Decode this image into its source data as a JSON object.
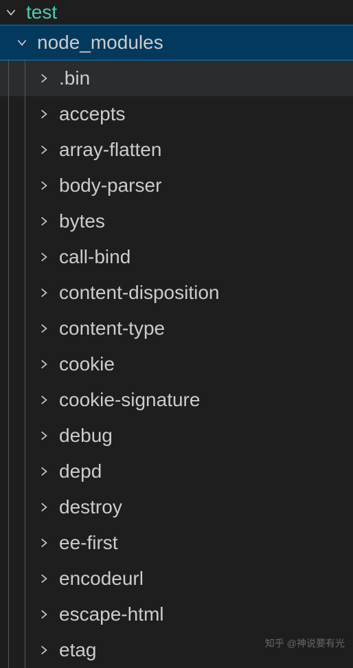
{
  "root": {
    "label": "test",
    "expanded": true
  },
  "node_modules": {
    "label": "node_modules",
    "expanded": true,
    "selected": true
  },
  "folders": [
    {
      "label": ".bin",
      "hovered": true
    },
    {
      "label": "accepts"
    },
    {
      "label": "array-flatten"
    },
    {
      "label": "body-parser"
    },
    {
      "label": "bytes"
    },
    {
      "label": "call-bind"
    },
    {
      "label": "content-disposition"
    },
    {
      "label": "content-type"
    },
    {
      "label": "cookie"
    },
    {
      "label": "cookie-signature"
    },
    {
      "label": "debug"
    },
    {
      "label": "depd"
    },
    {
      "label": "destroy"
    },
    {
      "label": "ee-first"
    },
    {
      "label": "encodeurl"
    },
    {
      "label": "escape-html"
    },
    {
      "label": "etag"
    }
  ],
  "watermark": "知乎 @神说要有光"
}
